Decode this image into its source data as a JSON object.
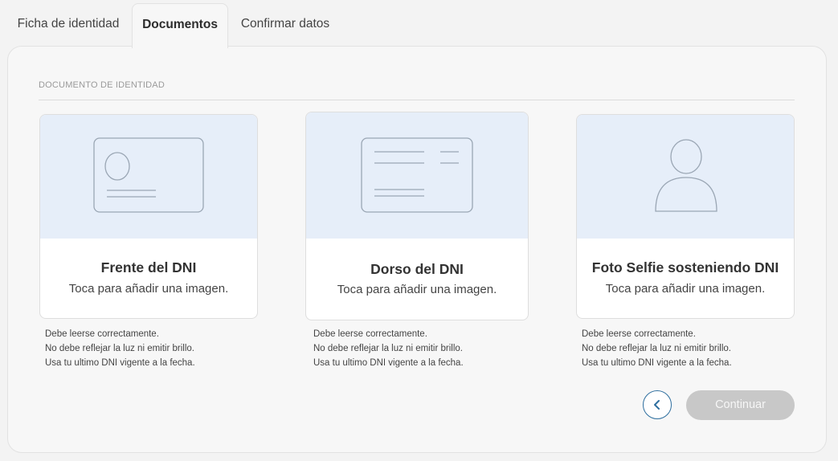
{
  "tabs": [
    {
      "label": "Ficha de identidad"
    },
    {
      "label": "Documentos",
      "active": true
    },
    {
      "label": "Confirmar datos"
    }
  ],
  "section": {
    "title": "DOCUMENTO DE IDENTIDAD"
  },
  "cards": [
    {
      "title": "Frente del DNI",
      "subtitle": "Toca para añadir una imagen.",
      "icon": "id-card-front-icon"
    },
    {
      "title": "Dorso del DNI",
      "subtitle": "Toca para añadir una imagen.",
      "icon": "id-card-back-icon"
    },
    {
      "title": "Foto Selfie sosteniendo DNI",
      "subtitle": "Toca para añadir una imagen.",
      "icon": "person-icon"
    }
  ],
  "notes": [
    [
      "Debe leerse correctamente.",
      "No debe reflejar la luz ni emitir brillo.",
      "Usa tu ultimo DNI vigente a la fecha."
    ],
    [
      "Debe leerse correctamente.",
      "No debe reflejar la luz ni emitir brillo.",
      "Usa tu ultimo DNI vigente a la fecha."
    ],
    [
      "Debe leerse correctamente.",
      "No debe reflejar la luz ni emitir brillo.",
      "Usa tu ultimo DNI vigente a la fecha."
    ]
  ],
  "actions": {
    "back_icon": "chevron-left-icon",
    "continue_label": "Continuar",
    "continue_enabled": false
  },
  "colors": {
    "accent": "#2f6f9f",
    "card_media_bg": "#e6eef9",
    "disabled_button": "#c8c8c8"
  }
}
